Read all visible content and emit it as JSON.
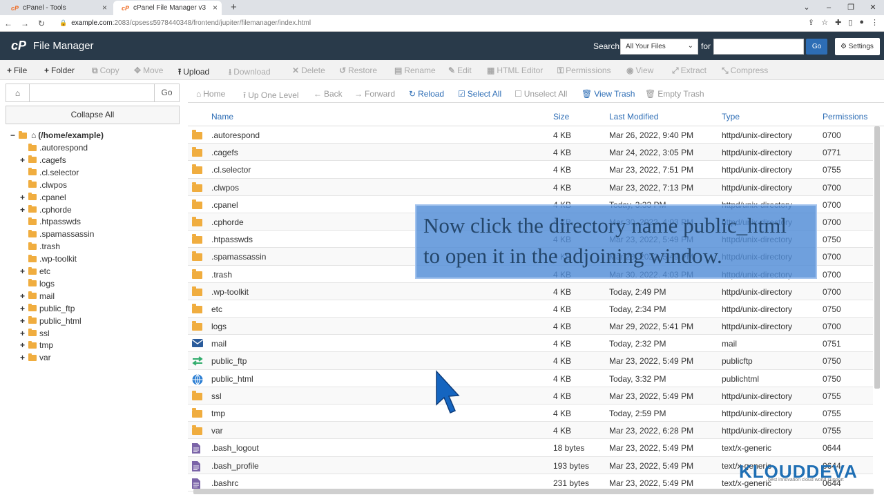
{
  "browser": {
    "tabs": [
      {
        "label": "cPanel - Tools",
        "active": false
      },
      {
        "label": "cPanel File Manager v3",
        "active": true
      }
    ],
    "url_host": "example.com",
    "url_path": ":2083/cpsess5978440348/frontend/jupiter/filemanager/index.html"
  },
  "header": {
    "logo": "cP",
    "title": "File Manager",
    "search_label": "Search",
    "search_scope": "All Your Files",
    "for_label": "for",
    "search_value": "",
    "go_label": "Go",
    "settings_label": "Settings"
  },
  "toolbar": [
    {
      "icon": "+",
      "label": "File",
      "enabled": true
    },
    {
      "icon": "+",
      "label": "Folder",
      "enabled": true
    },
    {
      "icon": "⧉",
      "label": "Copy",
      "enabled": false
    },
    {
      "icon": "✥",
      "label": "Move",
      "enabled": false
    },
    {
      "icon": "⭱",
      "label": "Upload",
      "enabled": true
    },
    {
      "icon": "⭳",
      "label": "Download",
      "enabled": false
    },
    {
      "icon": "✕",
      "label": "Delete",
      "enabled": false
    },
    {
      "icon": "↺",
      "label": "Restore",
      "enabled": false
    },
    {
      "icon": "▤",
      "label": "Rename",
      "enabled": false
    },
    {
      "icon": "✎",
      "label": "Edit",
      "enabled": false
    },
    {
      "icon": "▦",
      "label": "HTML Editor",
      "enabled": false
    },
    {
      "icon": "⚿",
      "label": "Permissions",
      "enabled": false
    },
    {
      "icon": "◉",
      "label": "View",
      "enabled": false
    },
    {
      "icon": "⤢",
      "label": "Extract",
      "enabled": false
    },
    {
      "icon": "⤡",
      "label": "Compress",
      "enabled": false
    }
  ],
  "left": {
    "go_label": "Go",
    "collapse_label": "Collapse All",
    "root_label": "(/home/example)",
    "tree": [
      {
        "label": ".autorespond",
        "expandable": false
      },
      {
        "label": ".cagefs",
        "expandable": true
      },
      {
        "label": ".cl.selector",
        "expandable": false
      },
      {
        "label": ".clwpos",
        "expandable": false
      },
      {
        "label": ".cpanel",
        "expandable": true
      },
      {
        "label": ".cphorde",
        "expandable": true
      },
      {
        "label": ".htpasswds",
        "expandable": false
      },
      {
        "label": ".spamassassin",
        "expandable": false
      },
      {
        "label": ".trash",
        "expandable": false
      },
      {
        "label": ".wp-toolkit",
        "expandable": false
      },
      {
        "label": "etc",
        "expandable": true
      },
      {
        "label": "logs",
        "expandable": false
      },
      {
        "label": "mail",
        "expandable": true
      },
      {
        "label": "public_ftp",
        "expandable": true
      },
      {
        "label": "public_html",
        "expandable": true
      },
      {
        "label": "ssl",
        "expandable": true
      },
      {
        "label": "tmp",
        "expandable": true
      },
      {
        "label": "var",
        "expandable": true
      }
    ]
  },
  "right_toolbar": [
    {
      "icon": "⌂",
      "label": "Home",
      "style": "grey"
    },
    {
      "icon": "⭱",
      "label": "Up One Level",
      "style": "grey"
    },
    {
      "icon": "←",
      "label": "Back",
      "style": "grey"
    },
    {
      "icon": "→",
      "label": "Forward",
      "style": "grey"
    },
    {
      "icon": "↻",
      "label": "Reload",
      "style": "blue"
    },
    {
      "icon": "☑",
      "label": "Select All",
      "style": "blue"
    },
    {
      "icon": "☐",
      "label": "Unselect All",
      "style": "grey"
    },
    {
      "icon": "🗑",
      "label": "View Trash",
      "style": "blue"
    },
    {
      "icon": "🗑",
      "label": "Empty Trash",
      "style": "grey"
    }
  ],
  "table": {
    "columns": [
      "Name",
      "Size",
      "Last Modified",
      "Type",
      "Permissions"
    ],
    "rows": [
      {
        "icon": "folder",
        "name": ".autorespond",
        "size": "4 KB",
        "modified": "Mar 26, 2022, 9:40 PM",
        "type": "httpd/unix-directory",
        "perms": "0700"
      },
      {
        "icon": "folder",
        "name": ".cagefs",
        "size": "4 KB",
        "modified": "Mar 24, 2022, 3:05 PM",
        "type": "httpd/unix-directory",
        "perms": "0771"
      },
      {
        "icon": "folder",
        "name": ".cl.selector",
        "size": "4 KB",
        "modified": "Mar 23, 2022, 7:51 PM",
        "type": "httpd/unix-directory",
        "perms": "0755"
      },
      {
        "icon": "folder",
        "name": ".clwpos",
        "size": "4 KB",
        "modified": "Mar 23, 2022, 7:13 PM",
        "type": "httpd/unix-directory",
        "perms": "0700"
      },
      {
        "icon": "folder",
        "name": ".cpanel",
        "size": "4 KB",
        "modified": "Today, 3:33 PM",
        "type": "httpd/unix-directory",
        "perms": "0700"
      },
      {
        "icon": "folder",
        "name": ".cphorde",
        "size": "4 KB",
        "modified": "Mar 30, 2022, 4:03 PM",
        "type": "httpd/unix-directory",
        "perms": "0700"
      },
      {
        "icon": "folder",
        "name": ".htpasswds",
        "size": "4 KB",
        "modified": "Mar 23, 2022, 5:49 PM",
        "type": "httpd/unix-directory",
        "perms": "0750"
      },
      {
        "icon": "folder",
        "name": ".spamassassin",
        "size": "4 KB",
        "modified": "Mar 23, 2022, 5:49 PM",
        "type": "httpd/unix-directory",
        "perms": "0700"
      },
      {
        "icon": "folder",
        "name": ".trash",
        "size": "4 KB",
        "modified": "Mar 30, 2022, 4:03 PM",
        "type": "httpd/unix-directory",
        "perms": "0700"
      },
      {
        "icon": "folder",
        "name": ".wp-toolkit",
        "size": "4 KB",
        "modified": "Today, 2:49 PM",
        "type": "httpd/unix-directory",
        "perms": "0700"
      },
      {
        "icon": "folder",
        "name": "etc",
        "size": "4 KB",
        "modified": "Today, 2:34 PM",
        "type": "httpd/unix-directory",
        "perms": "0750"
      },
      {
        "icon": "folder",
        "name": "logs",
        "size": "4 KB",
        "modified": "Mar 29, 2022, 5:41 PM",
        "type": "httpd/unix-directory",
        "perms": "0700"
      },
      {
        "icon": "mail",
        "name": "mail",
        "size": "4 KB",
        "modified": "Today, 2:32 PM",
        "type": "mail",
        "perms": "0751"
      },
      {
        "icon": "ftp",
        "name": "public_ftp",
        "size": "4 KB",
        "modified": "Mar 23, 2022, 5:49 PM",
        "type": "publicftp",
        "perms": "0750"
      },
      {
        "icon": "globe",
        "name": "public_html",
        "size": "4 KB",
        "modified": "Today, 3:32 PM",
        "type": "publichtml",
        "perms": "0750"
      },
      {
        "icon": "folder",
        "name": "ssl",
        "size": "4 KB",
        "modified": "Mar 23, 2022, 5:49 PM",
        "type": "httpd/unix-directory",
        "perms": "0755"
      },
      {
        "icon": "folder",
        "name": "tmp",
        "size": "4 KB",
        "modified": "Today, 2:59 PM",
        "type": "httpd/unix-directory",
        "perms": "0755"
      },
      {
        "icon": "folder",
        "name": "var",
        "size": "4 KB",
        "modified": "Mar 23, 2022, 6:28 PM",
        "type": "httpd/unix-directory",
        "perms": "0755"
      },
      {
        "icon": "file",
        "name": ".bash_logout",
        "size": "18 bytes",
        "modified": "Mar 23, 2022, 5:49 PM",
        "type": "text/x-generic",
        "perms": "0644"
      },
      {
        "icon": "file",
        "name": ".bash_profile",
        "size": "193 bytes",
        "modified": "Mar 23, 2022, 5:49 PM",
        "type": "text/x-generic",
        "perms": "0644"
      },
      {
        "icon": "file",
        "name": ".bashrc",
        "size": "231 bytes",
        "modified": "Mar 23, 2022, 5:49 PM",
        "type": "text/x-generic",
        "perms": "0644"
      }
    ]
  },
  "overlay": {
    "line1": "Now click the directory name public_html",
    "line2": "to open it in the adjoining window."
  },
  "watermark": {
    "brand": "KLOUDDEVA",
    "tagline": "best innovation cloud world support"
  },
  "colors": {
    "header_bg": "#293a4a",
    "accent_blue": "#2d6db5",
    "folder": "#f0ad3f"
  }
}
